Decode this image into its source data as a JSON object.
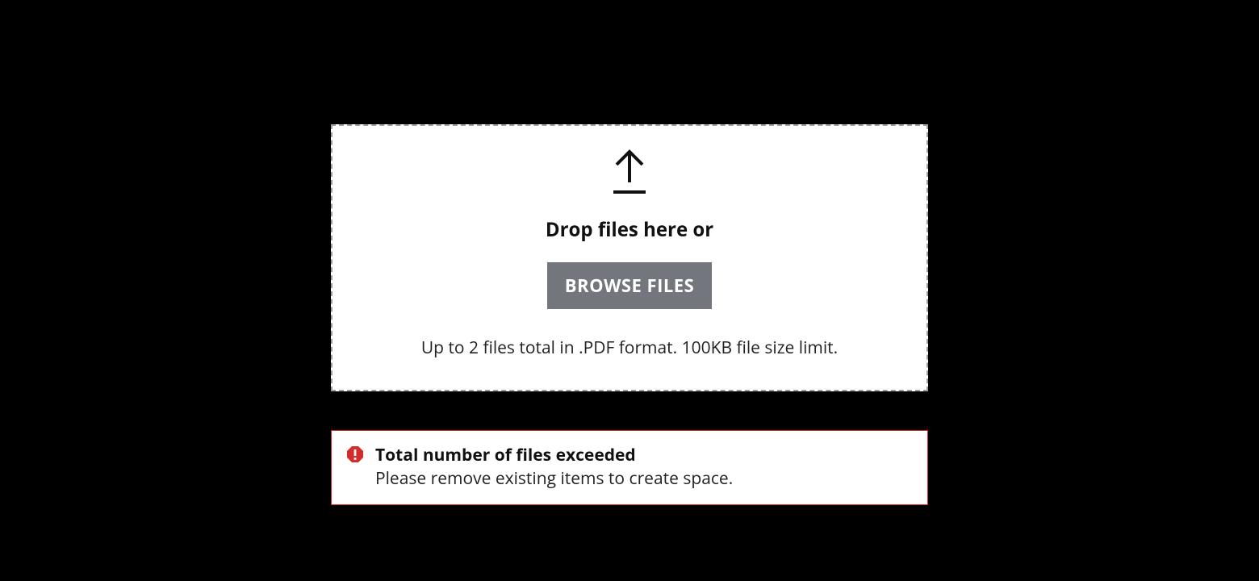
{
  "dropzone": {
    "title": "Drop files here or",
    "browse_label": "Browse Files",
    "hint": "Up to 2 files total in .PDF format. 100KB file size limit."
  },
  "alert": {
    "title": "Total number of files exceeded",
    "message": "Please remove existing items to create space."
  }
}
